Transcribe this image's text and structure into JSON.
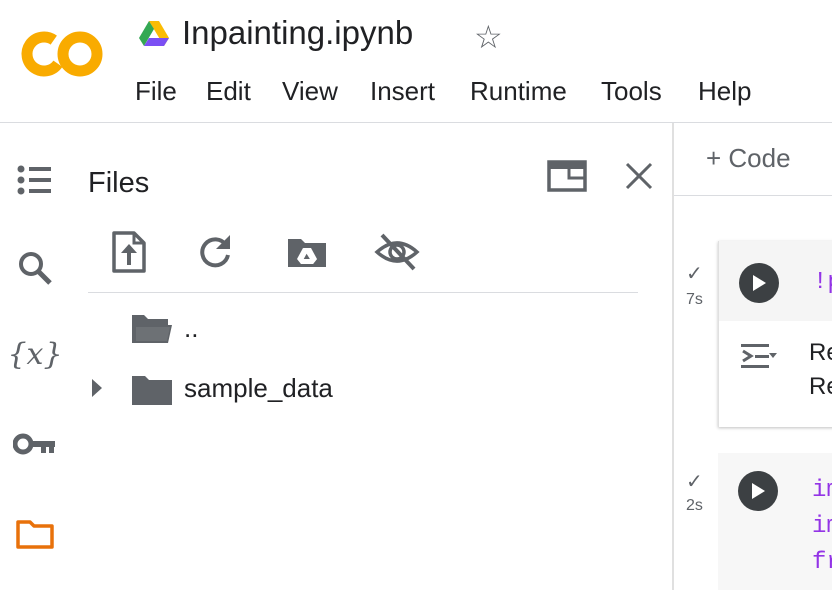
{
  "header": {
    "logo_text": "CO",
    "title": "Inpainting.ipynb",
    "menu": [
      "File",
      "Edit",
      "View",
      "Insert",
      "Runtime",
      "Tools",
      "Help"
    ]
  },
  "rail": {
    "icons": [
      "table-of-contents-icon",
      "search-icon",
      "variables-icon",
      "secrets-key-icon",
      "files-folder-icon"
    ],
    "variables_glyph": "{x}"
  },
  "files_panel": {
    "title": "Files",
    "toolbar": [
      "upload-file-icon",
      "refresh-icon",
      "mount-drive-icon",
      "toggle-hidden-files-icon"
    ],
    "items": [
      {
        "name": "..",
        "expandable": false
      },
      {
        "name": "sample_data",
        "expandable": true
      }
    ]
  },
  "notebook": {
    "add_code_label": "+ Code",
    "cells": [
      {
        "status": "✓",
        "time": "7s",
        "code": "!p",
        "output": [
          "Re",
          "Re"
        ]
      },
      {
        "status": "✓",
        "time": "2s",
        "code_lines": [
          "im",
          "im",
          "fr"
        ]
      }
    ]
  },
  "colors": {
    "accent": "#f9ab00",
    "code_keyword": "#9334e6",
    "icon": "#5f6368",
    "text": "#202124"
  }
}
